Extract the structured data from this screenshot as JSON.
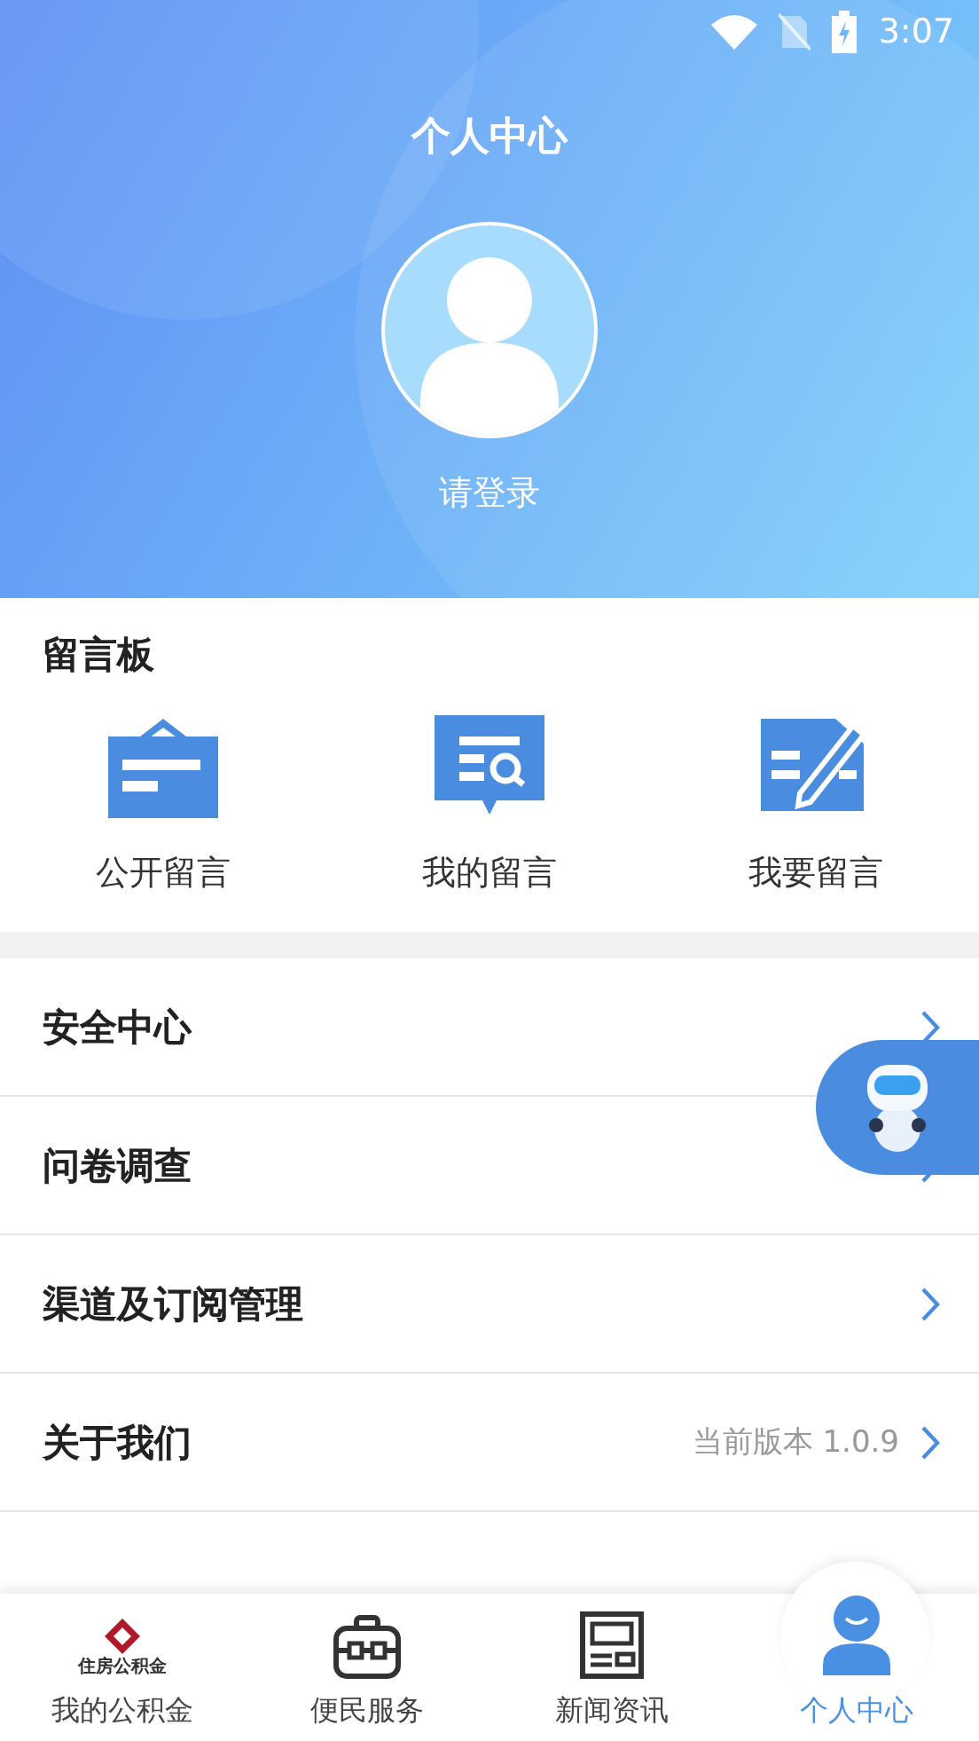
{
  "status_bar": {
    "time": "3:07"
  },
  "header": {
    "title": "个人中心",
    "login": "请登录"
  },
  "message_board": {
    "title": "留言板",
    "items": [
      {
        "kind": "public",
        "label": "公开留言"
      },
      {
        "kind": "mine",
        "label": "我的留言"
      },
      {
        "kind": "write",
        "label": "我要留言"
      }
    ]
  },
  "menu": [
    {
      "label": "安全中心"
    },
    {
      "label": "问卷调查"
    },
    {
      "label": "渠道及订阅管理"
    },
    {
      "label": "关于我们",
      "value": "当前版本 1.0.9"
    }
  ],
  "tab_bar": [
    {
      "kind": "logo",
      "label": "我的公积金",
      "logo_text": "住房公积金",
      "selected": false
    },
    {
      "kind": "briefcase",
      "label": "便民服务",
      "selected": false
    },
    {
      "kind": "news",
      "label": "新闻资讯",
      "selected": false
    },
    {
      "kind": "person",
      "label": "个人中心",
      "selected": true
    }
  ]
}
